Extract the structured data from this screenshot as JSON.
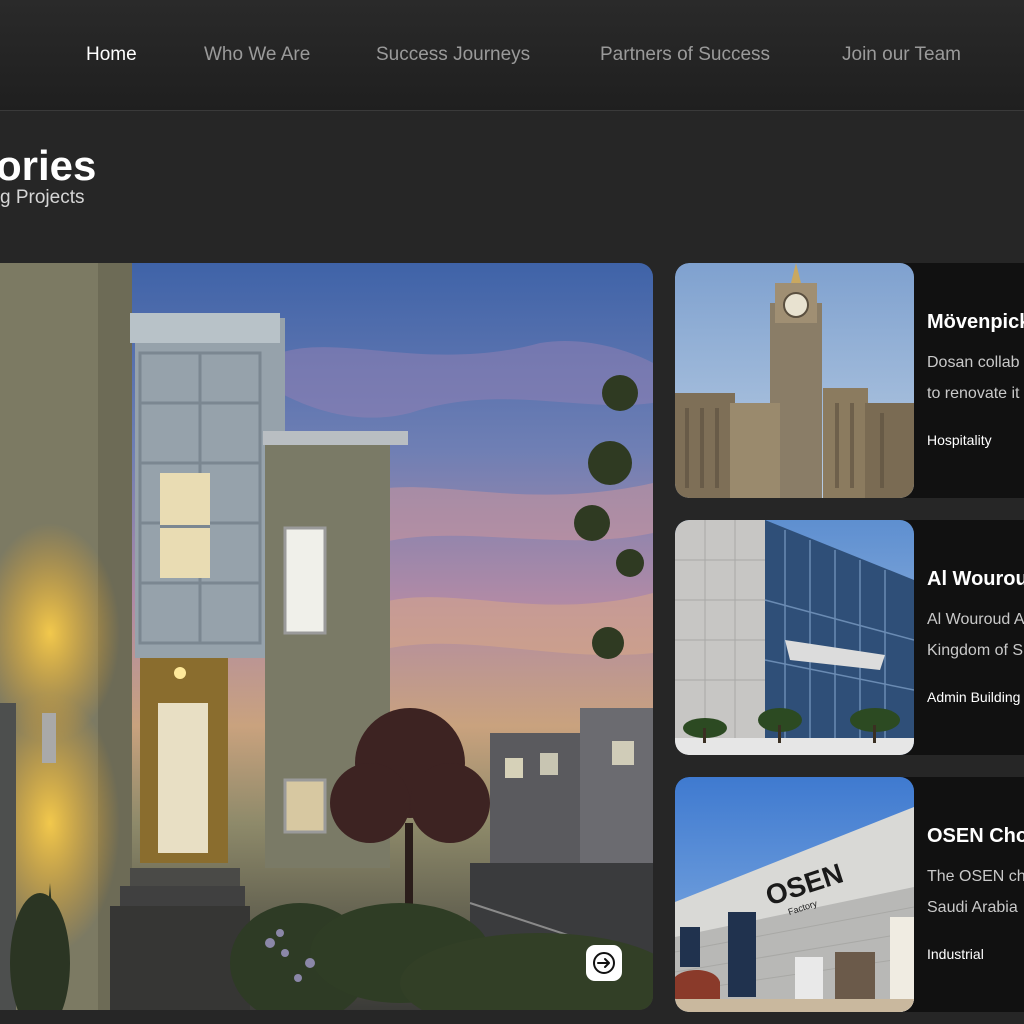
{
  "nav": {
    "items": [
      {
        "label": "Home",
        "active": true
      },
      {
        "label": "Who We Are",
        "active": false
      },
      {
        "label": "Success Journeys",
        "active": false
      },
      {
        "label": "Partners of Success",
        "active": false
      },
      {
        "label": "Join our Team",
        "active": false
      }
    ]
  },
  "hero": {
    "heading": "ories",
    "subheading": "g Projects"
  },
  "featured": {
    "image_icon": "house-photo",
    "next_icon": "arrow-right-icon"
  },
  "projects": [
    {
      "title": "Mövenpick",
      "desc_line1": "Dosan collab",
      "desc_line2": "to renovate it",
      "tag": "Hospitality",
      "image_icon": "clock-tower-photo"
    },
    {
      "title": "Al Wourou",
      "desc_line1": "Al Wouroud A",
      "desc_line2": "Kingdom of S",
      "tag": "Admin Building",
      "image_icon": "glass-building-photo"
    },
    {
      "title": "OSEN Cho",
      "desc_line1": "The OSEN ch",
      "desc_line2": "Saudi Arabia",
      "tag": "Industrial",
      "image_icon": "factory-photo",
      "sign_main": "OSEN",
      "sign_sub": "Factory"
    }
  ],
  "colors": {
    "background": "#262626",
    "card": "#111111",
    "nav_inactive": "#9a9a9a",
    "nav_active": "#ffffff"
  }
}
